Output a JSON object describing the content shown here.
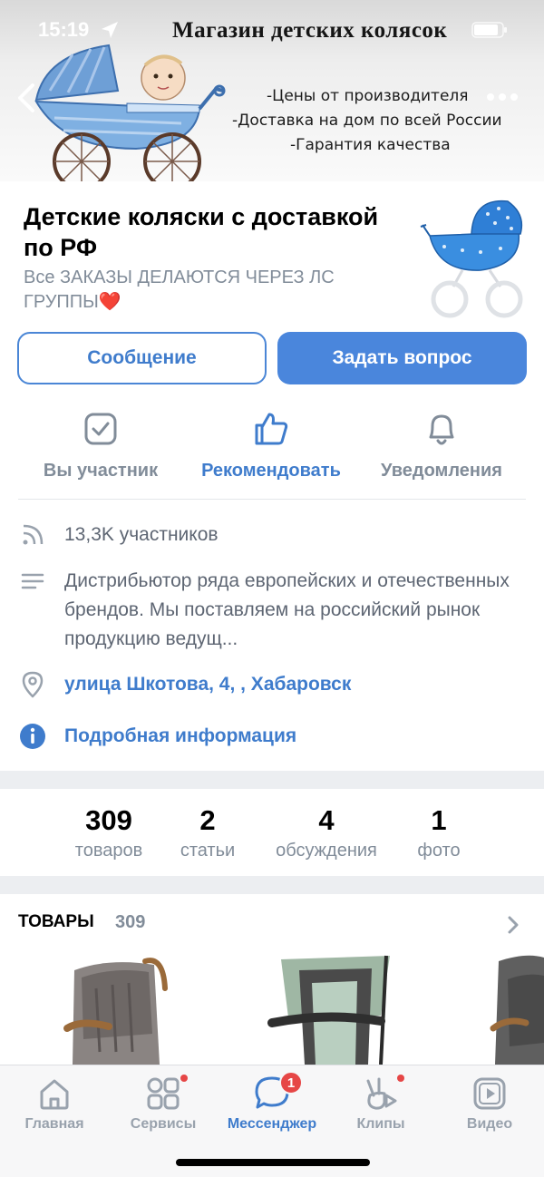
{
  "status_bar": {
    "time": "15:19"
  },
  "cover": {
    "title": "Магазин детских колясок",
    "lines": [
      "-Цены от производителя",
      "-Доставка на дом по всей России",
      "-Гарантия качества"
    ]
  },
  "group": {
    "name": "Детские коляски с доставкой по РФ",
    "status": "Все ЗАКАЗЫ ДЕЛАЮТСЯ ЧЕРЕЗ ЛС ГРУППЫ❤️"
  },
  "buttons": {
    "message": "Сообщение",
    "ask": "Задать вопрос"
  },
  "actions": [
    {
      "label": "Вы участник",
      "icon": "checkbox-icon"
    },
    {
      "label": "Рекомендовать",
      "icon": "thumbs-up-icon"
    },
    {
      "label": "Уведомления",
      "icon": "bell-icon"
    }
  ],
  "info": {
    "members": "13,3K участников",
    "description": "Дистрибьютор ряда европейских и отечественных брендов. Мы поставляем на российский рынок продукцию ведущ...",
    "address": "улица Шкотова, 4, , Хабаровск",
    "details": "Подробная информация"
  },
  "counters": [
    {
      "value": "309",
      "label": "товаров"
    },
    {
      "value": "2",
      "label": "статьи"
    },
    {
      "value": "4",
      "label": "обсуждения"
    },
    {
      "value": "1",
      "label": "фото"
    }
  ],
  "products": {
    "title": "ТОВАРЫ",
    "count": "309"
  },
  "tabs": [
    {
      "label": "Главная",
      "icon": "home-icon"
    },
    {
      "label": "Сервисы",
      "icon": "services-icon"
    },
    {
      "label": "Мессенджер",
      "icon": "messenger-icon",
      "badge": "1"
    },
    {
      "label": "Клипы",
      "icon": "clips-icon"
    },
    {
      "label": "Видео",
      "icon": "video-icon"
    }
  ],
  "colors": {
    "accent": "#4a86dc",
    "link": "#3f7ccc",
    "secondary_text": "#818c99",
    "badge": "#e64646"
  }
}
